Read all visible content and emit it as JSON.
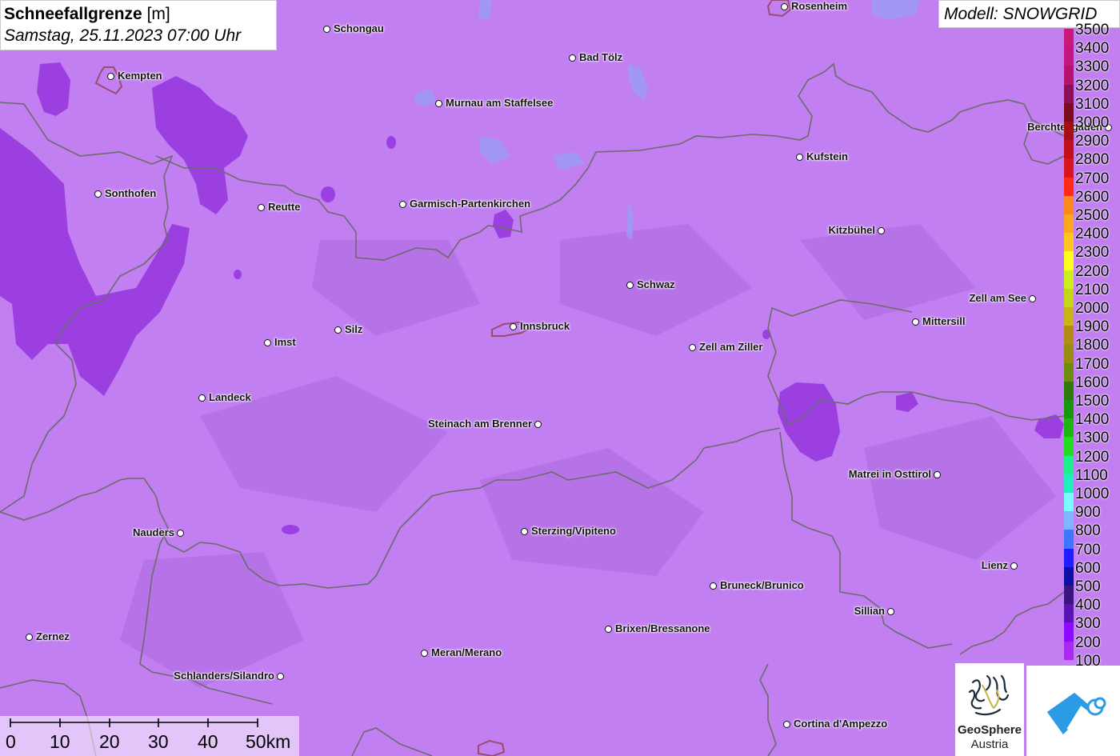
{
  "title": {
    "main": "Schneefallgrenze",
    "unit": "[m]",
    "subtitle": "Samstag, 25.11.2023 07:00 Uhr"
  },
  "model": "Modell: SNOWGRID",
  "colors": {
    "map_base": "#c27ff2",
    "purple_patch": "#9b3fe0",
    "border": "#6b6b6b"
  },
  "legend": {
    "items": [
      {
        "label": "3500",
        "color": "#c8197a"
      },
      {
        "label": "3400",
        "color": "#c31680"
      },
      {
        "label": "3300",
        "color": "#b5136f"
      },
      {
        "label": "3200",
        "color": "#8e0e5a"
      },
      {
        "label": "3100",
        "color": "#7a0d1d"
      },
      {
        "label": "3000",
        "color": "#a40e14"
      },
      {
        "label": "2900",
        "color": "#c0101c"
      },
      {
        "label": "2800",
        "color": "#d8141e"
      },
      {
        "label": "2700",
        "color": "#ff2a1a"
      },
      {
        "label": "2600",
        "color": "#ff8a1c"
      },
      {
        "label": "2500",
        "color": "#ffa81f"
      },
      {
        "label": "2400",
        "color": "#ffc61f"
      },
      {
        "label": "2300",
        "color": "#ffff1f"
      },
      {
        "label": "2200",
        "color": "#c8f01f"
      },
      {
        "label": "2100",
        "color": "#c3d61a"
      },
      {
        "label": "2000",
        "color": "#c8b418"
      },
      {
        "label": "1900",
        "color": "#b48c14"
      },
      {
        "label": "1800",
        "color": "#9a8c12"
      },
      {
        "label": "1700",
        "color": "#6c8c10"
      },
      {
        "label": "1600",
        "color": "#2e7a0c"
      },
      {
        "label": "1500",
        "color": "#18960c"
      },
      {
        "label": "1400",
        "color": "#1eb414"
      },
      {
        "label": "1300",
        "color": "#22dc1e"
      },
      {
        "label": "1200",
        "color": "#1ef08c"
      },
      {
        "label": "1100",
        "color": "#20f0c0"
      },
      {
        "label": "1000",
        "color": "#7cfcff"
      },
      {
        "label": "900",
        "color": "#82b4ff"
      },
      {
        "label": "800",
        "color": "#3c78ff"
      },
      {
        "label": "700",
        "color": "#1e1eff"
      },
      {
        "label": "600",
        "color": "#0e0ea8"
      },
      {
        "label": "500",
        "color": "#3c1482"
      },
      {
        "label": "400",
        "color": "#5a14b4"
      },
      {
        "label": "300",
        "color": "#8c0aff"
      },
      {
        "label": "200",
        "color": "#aa28f0"
      },
      {
        "label": "100",
        "color": "#c27ff2"
      }
    ]
  },
  "cities": [
    {
      "name": "Rosenheim",
      "dot": "left"
    },
    {
      "name": "Schongau",
      "dot": "left"
    },
    {
      "name": "Bad Tölz",
      "dot": "left"
    },
    {
      "name": "Kempten",
      "dot": "left"
    },
    {
      "name": "Murnau am Staffelsee",
      "dot": "left"
    },
    {
      "name": "Berchtesgaden",
      "dot": "right"
    },
    {
      "name": "Kufstein",
      "dot": "left"
    },
    {
      "name": "Sonthofen",
      "dot": "left"
    },
    {
      "name": "Reutte",
      "dot": "left"
    },
    {
      "name": "Garmisch-Partenkirchen",
      "dot": "left"
    },
    {
      "name": "Kitzbühel",
      "dot": "right"
    },
    {
      "name": "Schwaz",
      "dot": "left"
    },
    {
      "name": "Zell am See",
      "dot": "right"
    },
    {
      "name": "Mittersill",
      "dot": "left"
    },
    {
      "name": "Innsbruck",
      "dot": "left"
    },
    {
      "name": "Silz",
      "dot": "left"
    },
    {
      "name": "Imst",
      "dot": "left"
    },
    {
      "name": "Zell am Ziller",
      "dot": "left"
    },
    {
      "name": "Landeck",
      "dot": "left"
    },
    {
      "name": "Steinach am Brenner",
      "dot": "right"
    },
    {
      "name": "Matrei in Osttirol",
      "dot": "right"
    },
    {
      "name": "Nauders",
      "dot": "right"
    },
    {
      "name": "Sterzing/Vipiteno",
      "dot": "left"
    },
    {
      "name": "Lienz",
      "dot": "right"
    },
    {
      "name": "Bruneck/Brunico",
      "dot": "left"
    },
    {
      "name": "Sillian",
      "dot": "right"
    },
    {
      "name": "Brixen/Bressanone",
      "dot": "left"
    },
    {
      "name": "Zernez",
      "dot": "left"
    },
    {
      "name": "Meran/Merano",
      "dot": "left"
    },
    {
      "name": "Schlanders/Silandro",
      "dot": "right"
    },
    {
      "name": "Cortina d'Ampezzo",
      "dot": "left"
    }
  ],
  "scale_bar": {
    "ticks": [
      "0",
      "10",
      "20",
      "30",
      "40",
      "50km"
    ]
  },
  "logos": {
    "geosphere_name": "GeoSphere",
    "geosphere_sub": "Austria"
  }
}
